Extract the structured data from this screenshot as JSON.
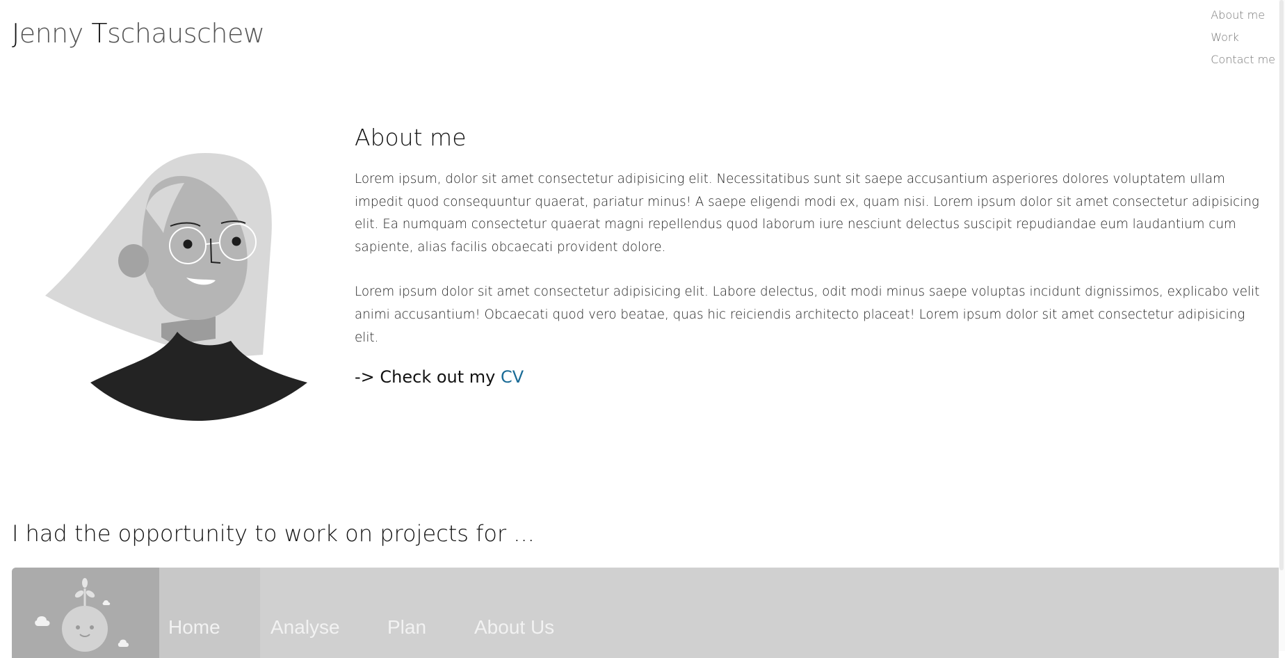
{
  "header": {
    "brand": {
      "first_initial": "J",
      "first_rest": "enny ",
      "last_initial": "T",
      "last_rest": "schauschew"
    },
    "nav": [
      {
        "label": "About me"
      },
      {
        "label": "Work"
      },
      {
        "label": "Contact me"
      }
    ]
  },
  "about": {
    "avatar_icon": "woman-with-glasses-illustration",
    "title": "About me",
    "paragraphs": [
      "Lorem ipsum, dolor sit amet consectetur adipisicing elit. Necessitatibus sunt sit saepe accusantium asperiores dolores voluptatem ullam impedit quod consequuntur quaerat, pariatur minus! A saepe eligendi modi ex, quam nisi. Lorem ipsum dolor sit amet consectetur adipisicing elit. Ea numquam consectetur quaerat magni repellendus quod laborum iure nesciunt delectus suscipit repudiandae eum laudantium cum sapiente, alias facilis obcaecati provident dolore.",
      "Lorem ipsum dolor sit amet consectetur adipisicing elit. Labore delectus, odit modi minus saepe voluptas incidunt dignissimos, explicabo velit animi accusantium! Obcaecati quod vero beatae, quas hic reiciendis architecto placeat! Lorem ipsum dolor sit amet consectetur adipisicing elit."
    ],
    "cv_prefix": "-> Check out my ",
    "cv_link": "CV"
  },
  "projects": {
    "title": "I had the opportunity to work on projects for ...",
    "preview": {
      "logo_icon": "globe-plant-icon",
      "nav": [
        "Home",
        "Analyse",
        "Plan",
        "About Us"
      ]
    }
  },
  "colors": {
    "link": "#1a6b96",
    "preview_bg": "#d0d0d0"
  }
}
